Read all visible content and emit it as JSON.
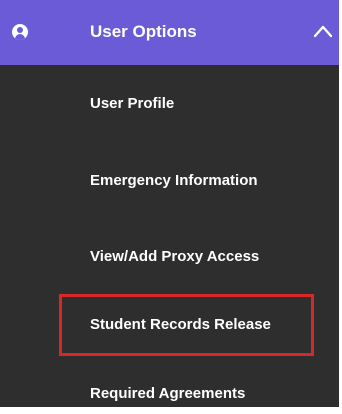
{
  "menu": {
    "header": {
      "title": "User Options",
      "icon": "user-circle-icon",
      "toggle_icon": "chevron-up-icon",
      "background": "#6b5bd6"
    },
    "items": [
      {
        "label": "User Profile"
      },
      {
        "label": "Emergency Information"
      },
      {
        "label": "View/Add Proxy Access"
      },
      {
        "label": "Student Records Release",
        "highlighted": true
      },
      {
        "label": "Required Agreements"
      }
    ],
    "background": "#2e2e2e",
    "highlight_color": "#d62828"
  }
}
